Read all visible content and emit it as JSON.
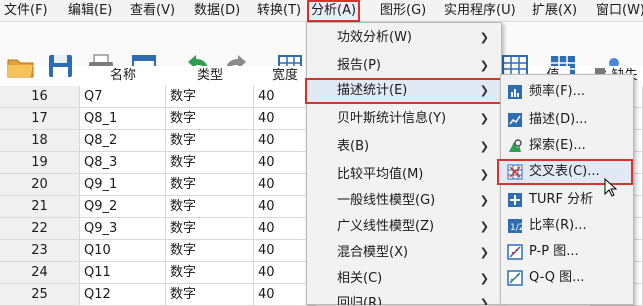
{
  "menubar": {
    "items": [
      "文件(F)",
      "编辑(E)",
      "查看(V)",
      "数据(D)",
      "转换(T)",
      "分析(A)",
      "图形(G)",
      "实用程序(U)",
      "扩展(X)",
      "窗口(W)"
    ]
  },
  "grid": {
    "headers": [
      "名称",
      "类型",
      "宽度",
      "值",
      "缺失"
    ],
    "rows": [
      {
        "num": "16",
        "name": "Q7",
        "type": "数字",
        "width": "40"
      },
      {
        "num": "17",
        "name": "Q8_1",
        "type": "数字",
        "width": "40"
      },
      {
        "num": "18",
        "name": "Q8_2",
        "type": "数字",
        "width": "40"
      },
      {
        "num": "19",
        "name": "Q8_3",
        "type": "数字",
        "width": "40"
      },
      {
        "num": "20",
        "name": "Q9_1",
        "type": "数字",
        "width": "40"
      },
      {
        "num": "21",
        "name": "Q9_2",
        "type": "数字",
        "width": "40"
      },
      {
        "num": "22",
        "name": "Q9_3",
        "type": "数字",
        "width": "40"
      },
      {
        "num": "23",
        "name": "Q10",
        "type": "数字",
        "width": "40"
      },
      {
        "num": "24",
        "name": "Q11",
        "type": "数字",
        "width": "40"
      },
      {
        "num": "25",
        "name": "Q12",
        "type": "数字",
        "width": "40"
      }
    ]
  },
  "analyze_menu": {
    "items": [
      {
        "label": "功效分析(W)"
      },
      {
        "label": "报告(P)"
      },
      {
        "label": "描述统计(E)"
      },
      {
        "label": "贝叶斯统计信息(Y)"
      },
      {
        "label": "表(B)"
      },
      {
        "label": "比较平均值(M)"
      },
      {
        "label": "一般线性模型(G)"
      },
      {
        "label": "广义线性模型(Z)"
      },
      {
        "label": "混合模型(X)"
      },
      {
        "label": "相关(C)"
      },
      {
        "label": "回归(R)"
      }
    ]
  },
  "descriptives_submenu": {
    "items": [
      {
        "label": "频率(F)...",
        "icon": "frequencies-icon"
      },
      {
        "label": "描述(D)...",
        "icon": "descriptives-icon"
      },
      {
        "label": "探索(E)...",
        "icon": "explore-icon"
      },
      {
        "label": "交叉表(C)...",
        "icon": "crosstabs-icon"
      },
      {
        "label": "TURF 分析",
        "icon": "turf-icon"
      },
      {
        "label": "比率(R)...",
        "icon": "ratio-icon"
      },
      {
        "label": "P-P 图...",
        "icon": "pp-plot-icon"
      },
      {
        "label": "Q-Q 图...",
        "icon": "qq-plot-icon"
      }
    ]
  },
  "colors": {
    "highlight_border": "#d6332b",
    "highlight_bg": "#e1e9f5"
  }
}
